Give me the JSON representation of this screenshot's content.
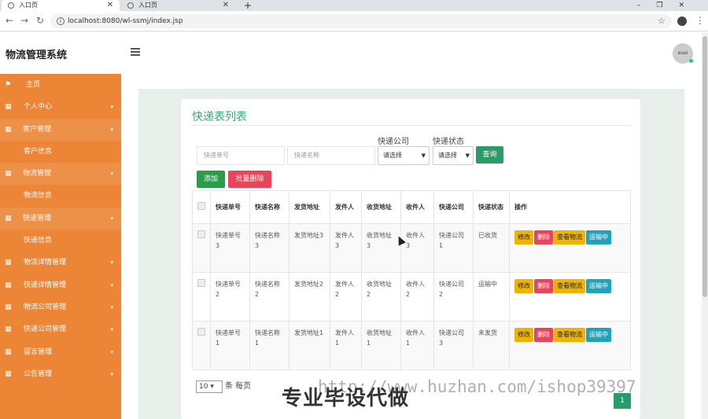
{
  "browser": {
    "tabs": [
      {
        "label": "入口页"
      },
      {
        "label": "入口页"
      }
    ],
    "url": "localhost:8080/wl-ssmj/index.jsp"
  },
  "header": {
    "app_title": "物流管理系统",
    "avatar_text": "80x80"
  },
  "sidebar": {
    "items": [
      {
        "label": "主页"
      },
      {
        "label": "个人中心"
      },
      {
        "label": "客户管理"
      },
      {
        "label": "客户信息"
      },
      {
        "label": "物流管理"
      },
      {
        "label": "物流信息"
      },
      {
        "label": "快递管理"
      },
      {
        "label": "快递信息"
      },
      {
        "label": "物流详情管理"
      },
      {
        "label": "快递详情管理"
      },
      {
        "label": "物流公司管理"
      },
      {
        "label": "快递公司管理"
      },
      {
        "label": "留言管理"
      },
      {
        "label": "公告管理"
      }
    ]
  },
  "page": {
    "title": "快递表列表",
    "search": {
      "number_placeholder": "快递单号",
      "name_placeholder": "快递名称",
      "company_label": "快递公司",
      "company_value": "请选择",
      "status_label": "快递状态",
      "status_value": "请选择",
      "query_button": "查询"
    },
    "add_button": "添加",
    "batch_delete_button": "批量删除",
    "table": {
      "headers": [
        "",
        "快递单号",
        "快递名称",
        "发货地址",
        "发件人",
        "收货地址",
        "收件人",
        "快递公司",
        "快递状态",
        "操作"
      ],
      "rows": [
        {
          "number": "快递单号3",
          "name": "快递名称3",
          "from": "发货地址3",
          "sender": "发件人3",
          "to": "收货地址3",
          "receiver": "收件人3",
          "company": "快递公司1",
          "status": "已收货"
        },
        {
          "number": "快递单号2",
          "name": "快递名称2",
          "from": "发货地址2",
          "sender": "发件人2",
          "to": "收货地址2",
          "receiver": "收件人2",
          "company": "快递公司2",
          "status": "运输中"
        },
        {
          "number": "快递单号1",
          "name": "快递名称1",
          "from": "发货地址1",
          "sender": "发件人1",
          "to": "收货地址1",
          "receiver": "收件人1",
          "company": "快递公司3",
          "status": "未发货"
        }
      ],
      "actions": {
        "edit": "修改",
        "delete": "删除",
        "view": "查看物流",
        "run": "运输中"
      }
    },
    "pager": {
      "page_size": "10",
      "suffix": "条 每页",
      "current_page": "1"
    }
  },
  "watermark": {
    "main": "专业毕设代做",
    "url": "http://www.huzhan.com/ishop39397"
  },
  "colors": {
    "sidebar": "#ec8535",
    "accent": "#3aa87b",
    "primary": "#2a9c69"
  }
}
